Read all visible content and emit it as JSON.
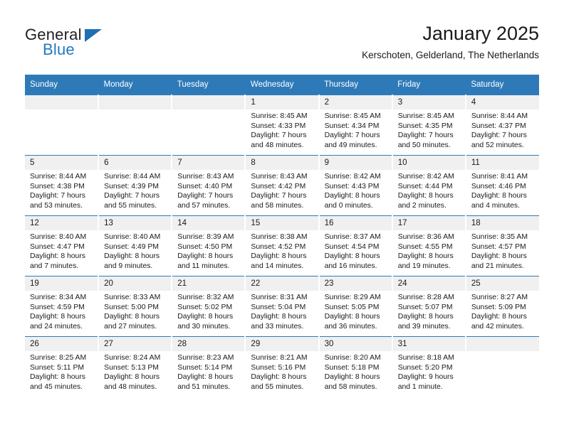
{
  "brand": {
    "line1": "General",
    "line2": "Blue",
    "logo_icon": "blue-triangle-icon",
    "colors": {
      "general_text": "#231f20",
      "blue_text": "#1f7ac0",
      "triangle": "#1f6fb5"
    }
  },
  "header": {
    "title": "January 2025",
    "subtitle": "Kerschoten, Gelderland, The Netherlands"
  },
  "theme": {
    "header_row_bg": "#2e7ab8",
    "header_row_text": "#ffffff",
    "daynum_bg": "#f0f0f0",
    "row_border": "#2e7ab8"
  },
  "calendar": {
    "weekday_headers": [
      "Sunday",
      "Monday",
      "Tuesday",
      "Wednesday",
      "Thursday",
      "Friday",
      "Saturday"
    ],
    "labels": {
      "sunrise": "Sunrise:",
      "sunset": "Sunset:",
      "daylight": "Daylight:"
    },
    "weeks": [
      [
        {
          "day": "",
          "empty": true
        },
        {
          "day": "",
          "empty": true
        },
        {
          "day": "",
          "empty": true
        },
        {
          "day": "1",
          "sunrise": "Sunrise: 8:45 AM",
          "sunset": "Sunset: 4:33 PM",
          "daylight_a": "Daylight: 7 hours",
          "daylight_b": "and 48 minutes."
        },
        {
          "day": "2",
          "sunrise": "Sunrise: 8:45 AM",
          "sunset": "Sunset: 4:34 PM",
          "daylight_a": "Daylight: 7 hours",
          "daylight_b": "and 49 minutes."
        },
        {
          "day": "3",
          "sunrise": "Sunrise: 8:45 AM",
          "sunset": "Sunset: 4:35 PM",
          "daylight_a": "Daylight: 7 hours",
          "daylight_b": "and 50 minutes."
        },
        {
          "day": "4",
          "sunrise": "Sunrise: 8:44 AM",
          "sunset": "Sunset: 4:37 PM",
          "daylight_a": "Daylight: 7 hours",
          "daylight_b": "and 52 minutes."
        }
      ],
      [
        {
          "day": "5",
          "sunrise": "Sunrise: 8:44 AM",
          "sunset": "Sunset: 4:38 PM",
          "daylight_a": "Daylight: 7 hours",
          "daylight_b": "and 53 minutes."
        },
        {
          "day": "6",
          "sunrise": "Sunrise: 8:44 AM",
          "sunset": "Sunset: 4:39 PM",
          "daylight_a": "Daylight: 7 hours",
          "daylight_b": "and 55 minutes."
        },
        {
          "day": "7",
          "sunrise": "Sunrise: 8:43 AM",
          "sunset": "Sunset: 4:40 PM",
          "daylight_a": "Daylight: 7 hours",
          "daylight_b": "and 57 minutes."
        },
        {
          "day": "8",
          "sunrise": "Sunrise: 8:43 AM",
          "sunset": "Sunset: 4:42 PM",
          "daylight_a": "Daylight: 7 hours",
          "daylight_b": "and 58 minutes."
        },
        {
          "day": "9",
          "sunrise": "Sunrise: 8:42 AM",
          "sunset": "Sunset: 4:43 PM",
          "daylight_a": "Daylight: 8 hours",
          "daylight_b": "and 0 minutes."
        },
        {
          "day": "10",
          "sunrise": "Sunrise: 8:42 AM",
          "sunset": "Sunset: 4:44 PM",
          "daylight_a": "Daylight: 8 hours",
          "daylight_b": "and 2 minutes."
        },
        {
          "day": "11",
          "sunrise": "Sunrise: 8:41 AM",
          "sunset": "Sunset: 4:46 PM",
          "daylight_a": "Daylight: 8 hours",
          "daylight_b": "and 4 minutes."
        }
      ],
      [
        {
          "day": "12",
          "sunrise": "Sunrise: 8:40 AM",
          "sunset": "Sunset: 4:47 PM",
          "daylight_a": "Daylight: 8 hours",
          "daylight_b": "and 7 minutes."
        },
        {
          "day": "13",
          "sunrise": "Sunrise: 8:40 AM",
          "sunset": "Sunset: 4:49 PM",
          "daylight_a": "Daylight: 8 hours",
          "daylight_b": "and 9 minutes."
        },
        {
          "day": "14",
          "sunrise": "Sunrise: 8:39 AM",
          "sunset": "Sunset: 4:50 PM",
          "daylight_a": "Daylight: 8 hours",
          "daylight_b": "and 11 minutes."
        },
        {
          "day": "15",
          "sunrise": "Sunrise: 8:38 AM",
          "sunset": "Sunset: 4:52 PM",
          "daylight_a": "Daylight: 8 hours",
          "daylight_b": "and 14 minutes."
        },
        {
          "day": "16",
          "sunrise": "Sunrise: 8:37 AM",
          "sunset": "Sunset: 4:54 PM",
          "daylight_a": "Daylight: 8 hours",
          "daylight_b": "and 16 minutes."
        },
        {
          "day": "17",
          "sunrise": "Sunrise: 8:36 AM",
          "sunset": "Sunset: 4:55 PM",
          "daylight_a": "Daylight: 8 hours",
          "daylight_b": "and 19 minutes."
        },
        {
          "day": "18",
          "sunrise": "Sunrise: 8:35 AM",
          "sunset": "Sunset: 4:57 PM",
          "daylight_a": "Daylight: 8 hours",
          "daylight_b": "and 21 minutes."
        }
      ],
      [
        {
          "day": "19",
          "sunrise": "Sunrise: 8:34 AM",
          "sunset": "Sunset: 4:59 PM",
          "daylight_a": "Daylight: 8 hours",
          "daylight_b": "and 24 minutes."
        },
        {
          "day": "20",
          "sunrise": "Sunrise: 8:33 AM",
          "sunset": "Sunset: 5:00 PM",
          "daylight_a": "Daylight: 8 hours",
          "daylight_b": "and 27 minutes."
        },
        {
          "day": "21",
          "sunrise": "Sunrise: 8:32 AM",
          "sunset": "Sunset: 5:02 PM",
          "daylight_a": "Daylight: 8 hours",
          "daylight_b": "and 30 minutes."
        },
        {
          "day": "22",
          "sunrise": "Sunrise: 8:31 AM",
          "sunset": "Sunset: 5:04 PM",
          "daylight_a": "Daylight: 8 hours",
          "daylight_b": "and 33 minutes."
        },
        {
          "day": "23",
          "sunrise": "Sunrise: 8:29 AM",
          "sunset": "Sunset: 5:05 PM",
          "daylight_a": "Daylight: 8 hours",
          "daylight_b": "and 36 minutes."
        },
        {
          "day": "24",
          "sunrise": "Sunrise: 8:28 AM",
          "sunset": "Sunset: 5:07 PM",
          "daylight_a": "Daylight: 8 hours",
          "daylight_b": "and 39 minutes."
        },
        {
          "day": "25",
          "sunrise": "Sunrise: 8:27 AM",
          "sunset": "Sunset: 5:09 PM",
          "daylight_a": "Daylight: 8 hours",
          "daylight_b": "and 42 minutes."
        }
      ],
      [
        {
          "day": "26",
          "sunrise": "Sunrise: 8:25 AM",
          "sunset": "Sunset: 5:11 PM",
          "daylight_a": "Daylight: 8 hours",
          "daylight_b": "and 45 minutes."
        },
        {
          "day": "27",
          "sunrise": "Sunrise: 8:24 AM",
          "sunset": "Sunset: 5:13 PM",
          "daylight_a": "Daylight: 8 hours",
          "daylight_b": "and 48 minutes."
        },
        {
          "day": "28",
          "sunrise": "Sunrise: 8:23 AM",
          "sunset": "Sunset: 5:14 PM",
          "daylight_a": "Daylight: 8 hours",
          "daylight_b": "and 51 minutes."
        },
        {
          "day": "29",
          "sunrise": "Sunrise: 8:21 AM",
          "sunset": "Sunset: 5:16 PM",
          "daylight_a": "Daylight: 8 hours",
          "daylight_b": "and 55 minutes."
        },
        {
          "day": "30",
          "sunrise": "Sunrise: 8:20 AM",
          "sunset": "Sunset: 5:18 PM",
          "daylight_a": "Daylight: 8 hours",
          "daylight_b": "and 58 minutes."
        },
        {
          "day": "31",
          "sunrise": "Sunrise: 8:18 AM",
          "sunset": "Sunset: 5:20 PM",
          "daylight_a": "Daylight: 9 hours",
          "daylight_b": "and 1 minute."
        },
        {
          "day": "",
          "empty": true
        }
      ]
    ]
  }
}
